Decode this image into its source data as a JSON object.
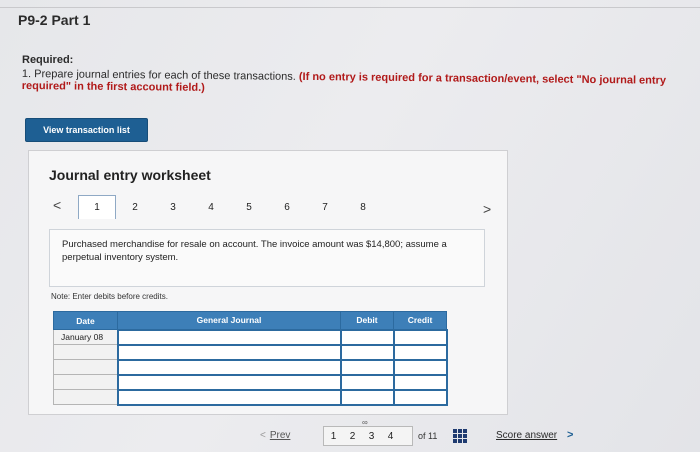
{
  "header": {
    "part_title": "P9-2 Part 1"
  },
  "instructions": {
    "heading": "Required:",
    "item": "1. Prepare journal entries for each of these transactions.",
    "note": "(If no entry is required for a transaction/event, select \"No journal entry required\" in the first account field.)"
  },
  "buttons": {
    "view_transactions": "View transaction list"
  },
  "worksheet": {
    "title": "Journal entry worksheet",
    "prev_arrow": "<",
    "next_arrow": ">",
    "tabs": [
      "1",
      "2",
      "3",
      "4",
      "5",
      "6",
      "7",
      "8"
    ],
    "active_tab": "1",
    "description": "Purchased merchandise for resale on account. The invoice amount was $14,800; assume a perpetual inventory system.",
    "note": "Note: Enter debits before credits.",
    "table": {
      "headers": [
        "Date",
        "General Journal",
        "Debit",
        "Credit"
      ],
      "rows": [
        [
          "January 08",
          "",
          "",
          ""
        ],
        [
          "",
          "",
          "",
          ""
        ],
        [
          "",
          "",
          "",
          ""
        ],
        [
          "",
          "",
          "",
          ""
        ],
        [
          "",
          "",
          "",
          ""
        ]
      ]
    }
  },
  "pagination": {
    "prev_label": "Prev",
    "pages": [
      "1",
      "2",
      "3",
      "4"
    ],
    "of_label": "of 11",
    "score_label": "Score answer",
    "score_arrow": ">"
  }
}
